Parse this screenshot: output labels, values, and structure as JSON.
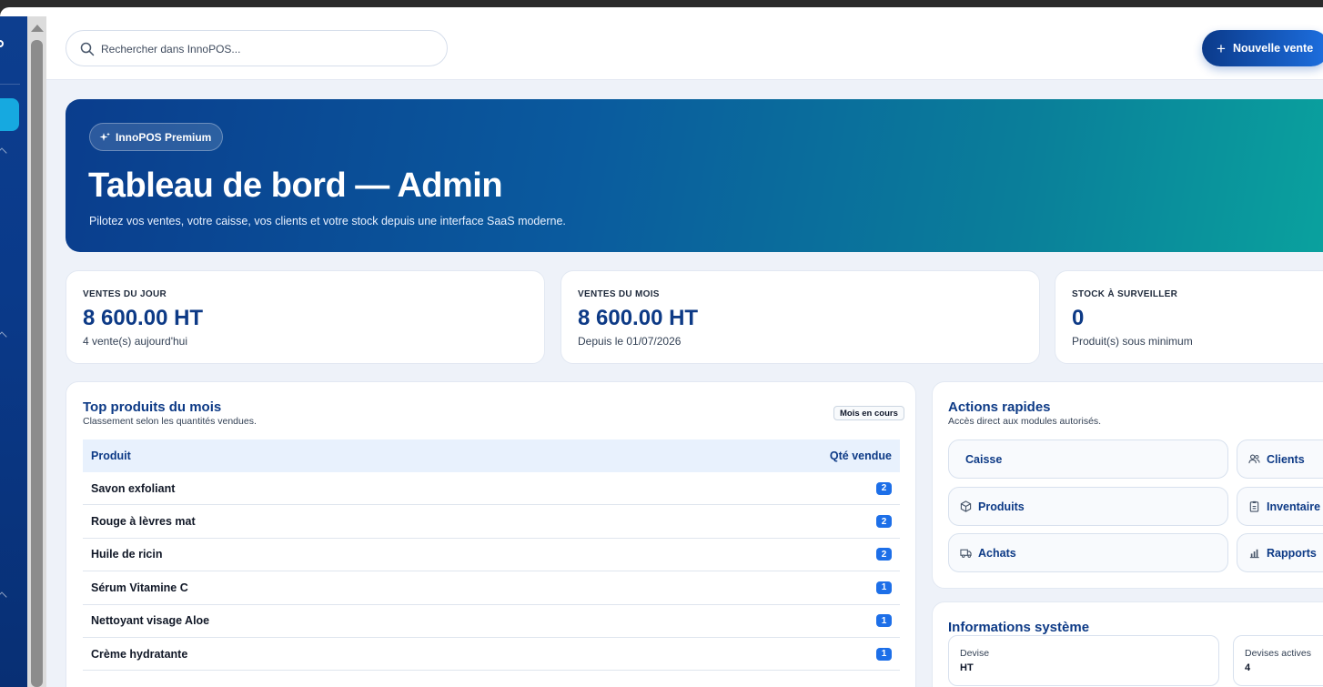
{
  "header": {
    "search_placeholder": "Rechercher dans InnoPOS...",
    "new_sale_label": "Nouvelle vente"
  },
  "hero": {
    "badge": "InnoPOS Premium",
    "title": "Tableau de bord — Admin",
    "subtitle": "Pilotez vos ventes, votre caisse, vos clients et votre stock depuis une interface SaaS moderne."
  },
  "kpis": [
    {
      "label": "VENTES DU JOUR",
      "value": "8 600.00 HT",
      "sub": "4 vente(s) aujourd'hui"
    },
    {
      "label": "VENTES DU MOIS",
      "value": "8 600.00 HT",
      "sub": "Depuis le 01/07/2026"
    },
    {
      "label": "STOCK À SURVEILLER",
      "value": "0",
      "sub": "Produit(s) sous minimum"
    }
  ],
  "top_products": {
    "title": "Top produits du mois",
    "description": "Classement selon les quantités vendues.",
    "period_tag": "Mois en cours",
    "columns": [
      "Produit",
      "Qté vendue"
    ],
    "rows": [
      {
        "product": "Savon exfoliant",
        "qty": "2"
      },
      {
        "product": "Rouge à lèvres mat",
        "qty": "2"
      },
      {
        "product": "Huile de ricin",
        "qty": "2"
      },
      {
        "product": "Sérum Vitamine C",
        "qty": "1"
      },
      {
        "product": "Nettoyant visage Aloe",
        "qty": "1"
      },
      {
        "product": "Crème hydratante",
        "qty": "1"
      }
    ]
  },
  "quick_actions": {
    "title": "Actions rapides",
    "description": "Accès direct aux modules autorisés.",
    "items": [
      {
        "label": "Caisse",
        "icon": "none"
      },
      {
        "label": "Clients",
        "icon": "users-icon"
      },
      {
        "label": "Produits",
        "icon": "box-icon"
      },
      {
        "label": "Inventaire",
        "icon": "clipboard-icon"
      },
      {
        "label": "Achats",
        "icon": "truck-icon"
      },
      {
        "label": "Rapports",
        "icon": "bar-chart-icon"
      }
    ]
  },
  "system_info": {
    "title": "Informations système",
    "items": [
      {
        "key": "Devise",
        "value": "HT"
      },
      {
        "key": "Devises actives",
        "value": "4"
      }
    ]
  },
  "colors": {
    "brand_dark": "#0d3a86",
    "accent_blue": "#1d6fe8",
    "hero_gradient_start": "#0a3d8d",
    "hero_gradient_end": "#0aa39e"
  }
}
